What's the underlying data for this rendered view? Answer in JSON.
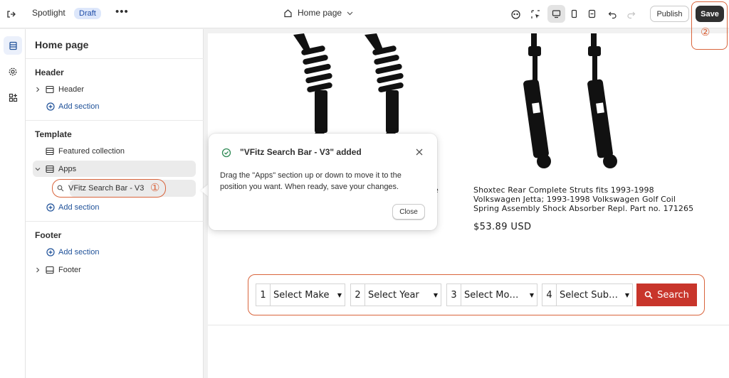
{
  "topbar": {
    "theme_name": "Spotlight",
    "status_badge": "Draft",
    "more_label": "•••",
    "page_selector": "Home page",
    "publish_label": "Publish",
    "save_label": "Save"
  },
  "sidebar": {
    "title": "Home page",
    "header_group": "Header",
    "header_item": "Header",
    "header_add": "Add section",
    "template_group": "Template",
    "template_items": [
      "Featured collection",
      "Apps"
    ],
    "apps_child": "VFitz Search Bar - V3",
    "template_add": "Add section",
    "footer_group": "Footer",
    "footer_add": "Add section",
    "footer_item": "Footer"
  },
  "annotations": {
    "callout_1": "①",
    "callout_2": "②"
  },
  "popover": {
    "title": "\"VFitz Search Bar - V3\" added",
    "body": "Drag the \"Apps\" section up or down to move it to the position you want. When ready, save your changes.",
    "close_label": "Close"
  },
  "preview": {
    "left_fragment_line1": "ge",
    "left_fragment_line2": "il",
    "product_title": "Shoxtec Rear Complete Struts fits 1993-1998 Volkswagen Jetta; 1993-1998 Volkswagen Golf Coil Spring Assembly Shock Absorber Repl. Part no. 171265",
    "product_price": "$53.89 USD",
    "search_fields": [
      {
        "num": "1",
        "label": "Select Make"
      },
      {
        "num": "2",
        "label": "Select Year"
      },
      {
        "num": "3",
        "label": "Select Mo…"
      },
      {
        "num": "4",
        "label": "Select Sub…"
      }
    ],
    "search_button": "Search"
  },
  "colors": {
    "accent_orange": "#d9643c",
    "search_red": "#c8352b",
    "link_blue": "#1f5199",
    "badge_bg": "#dde7fb"
  }
}
